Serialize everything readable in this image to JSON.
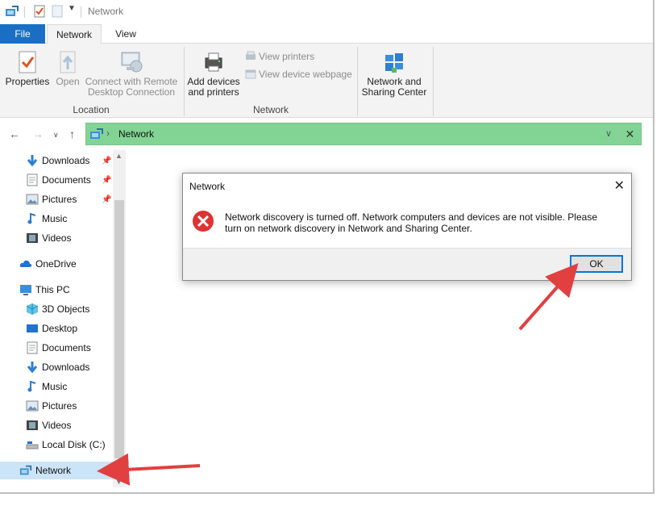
{
  "window": {
    "title": "Network"
  },
  "tabs": [
    {
      "label": "File"
    },
    {
      "label": "Network"
    },
    {
      "label": "View"
    }
  ],
  "ribbon": {
    "location_group": {
      "label": "Location",
      "properties": "Properties",
      "open": "Open",
      "connect_remote_line1": "Connect with Remote",
      "connect_remote_line2": "Desktop Connection"
    },
    "network_group": {
      "label": "Network",
      "add_devices_line1": "Add devices",
      "add_devices_line2": "and printers",
      "view_printers": "View printers",
      "view_device_webpage": "View device webpage"
    },
    "sharing": {
      "line1": "Network and",
      "line2": "Sharing Center"
    }
  },
  "address_bar": {
    "path": "Network",
    "highlight_color": "#82d494"
  },
  "nav_pane": {
    "quick_access": [
      {
        "label": "Downloads",
        "icon": "download-arrow-icon",
        "pinned": true
      },
      {
        "label": "Documents",
        "icon": "document-icon",
        "pinned": true
      },
      {
        "label": "Pictures",
        "icon": "pictures-icon",
        "pinned": true
      },
      {
        "label": "Music",
        "icon": "music-note-icon",
        "pinned": false
      },
      {
        "label": "Videos",
        "icon": "film-icon",
        "pinned": false
      }
    ],
    "onedrive": "OneDrive",
    "this_pc": "This PC",
    "this_pc_items": [
      {
        "label": "3D Objects",
        "icon": "cube-icon"
      },
      {
        "label": "Desktop",
        "icon": "desktop-icon"
      },
      {
        "label": "Documents",
        "icon": "document-icon"
      },
      {
        "label": "Downloads",
        "icon": "download-arrow-icon"
      },
      {
        "label": "Music",
        "icon": "music-note-icon"
      },
      {
        "label": "Pictures",
        "icon": "pictures-icon"
      },
      {
        "label": "Videos",
        "icon": "film-icon"
      },
      {
        "label": "Local Disk (C:)",
        "icon": "drive-icon"
      }
    ],
    "network": "Network"
  },
  "dialog": {
    "title": "Network",
    "message": "Network discovery is turned off. Network computers and devices are not visible. Please turn on network discovery in Network and Sharing Center.",
    "ok_label": "OK",
    "icon": "error-x-icon"
  },
  "annotations": {
    "arrow_color": "#e04040"
  }
}
